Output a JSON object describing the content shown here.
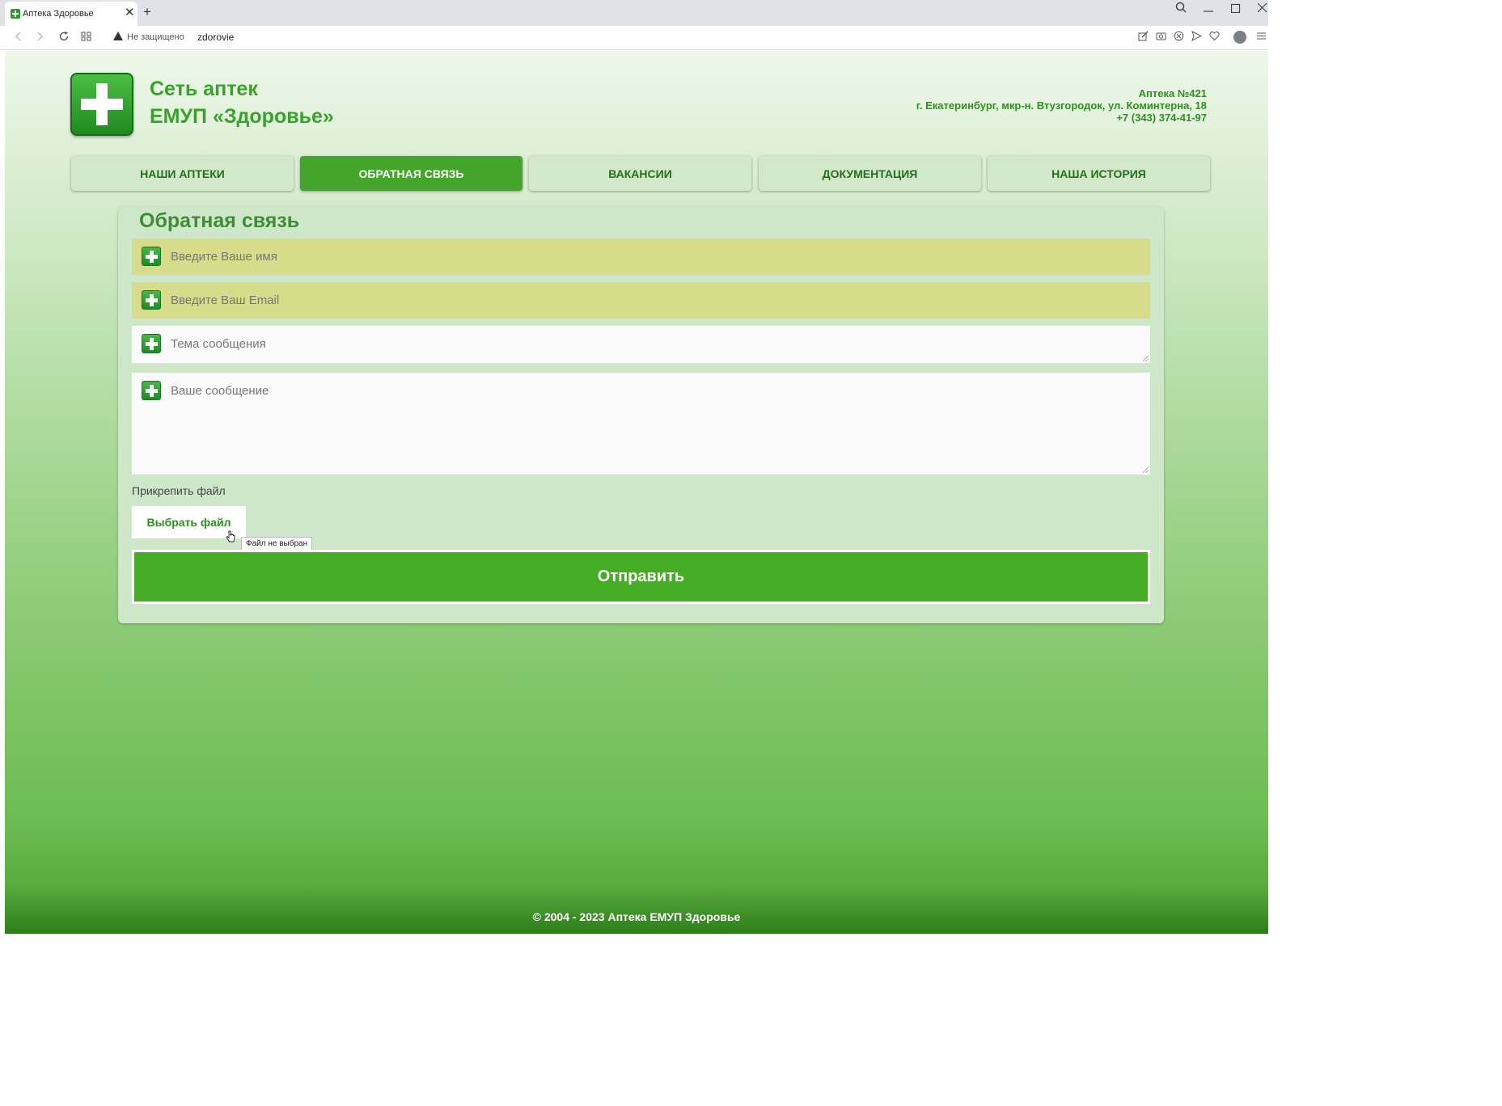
{
  "browser": {
    "tab_title": "Аптека Здоровье",
    "tab_close": "✕",
    "new_tab": "+",
    "security_text": "Не защищено",
    "url": "zdorovie"
  },
  "site": {
    "brand_line1": "Сеть аптек",
    "brand_line2": "ЕМУП «Здоровье»",
    "pharmacy_name": "Аптека №421",
    "address": "г. Екатеринбург, мкр-н. Втузгородок, ул. Коминтерна, 18",
    "phone": "+7 (343) 374-41-97"
  },
  "nav": {
    "items": [
      {
        "label": "НАШИ АПТЕКИ"
      },
      {
        "label": "ОБРАТНАЯ СВЯЗЬ"
      },
      {
        "label": "ВАКАНСИИ"
      },
      {
        "label": "ДОКУМЕНТАЦИЯ"
      },
      {
        "label": "НАША ИСТОРИЯ"
      }
    ],
    "active_index": 1
  },
  "form": {
    "title": "Обратная связь",
    "name_placeholder": "Введите Ваше имя",
    "email_placeholder": "Введите Ваш Email",
    "subject_placeholder": "Тема сообщения",
    "message_placeholder": "Ваше сообщение",
    "attach_label": "Прикрепить файл",
    "file_button": "Выбрать файл",
    "file_tooltip": "Файл не выбран",
    "submit_label": "Отправить"
  },
  "footer": {
    "text": "©  2004 - 2023  Аптека ЕМУП Здоровье"
  },
  "colors": {
    "brand_green": "#39a22c",
    "active_nav": "#44a52b",
    "submit_green": "#45ac23",
    "required_field": "#d7dc8a"
  }
}
